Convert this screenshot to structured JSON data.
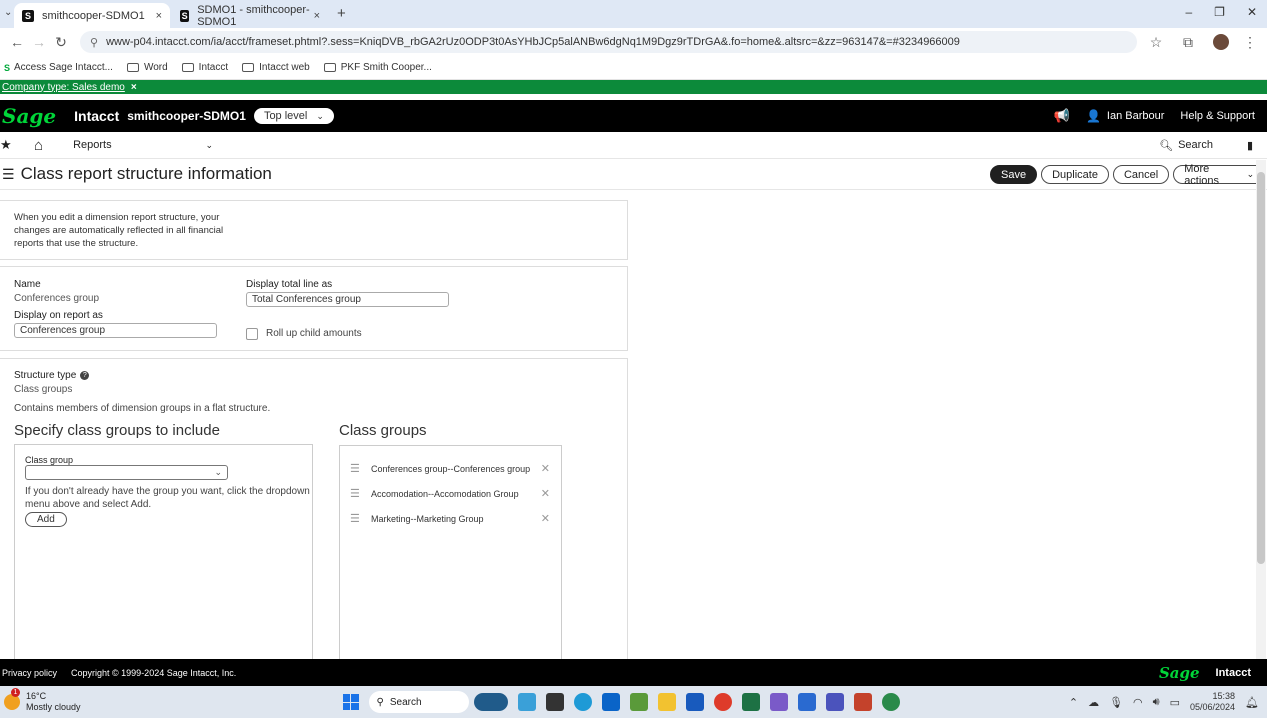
{
  "browser": {
    "tabs": [
      {
        "title": "smithcooper-SDMO1",
        "favicon": "S",
        "close": "×"
      },
      {
        "title": "SDMO1 - smithcooper-SDMO1",
        "favicon": "S",
        "close": "×"
      }
    ],
    "new_tab": "+",
    "url": "www-p04.intacct.com/ia/acct/frameset.phtml?.sess=KniqDVB_rbGA2rUz0ODP3t0AsYHbJCp5alANBw6dgNq1M9Dgz9rTDrGA&.fo=home&.altsrc=&zz=963147&=#3234966009",
    "bookmarks": [
      "Access Sage Intacct...",
      "Word",
      "Intacct",
      "Intacct web",
      "PKF Smith Cooper..."
    ]
  },
  "company_bar": {
    "text": "Company type: Sales demo",
    "close": "×"
  },
  "topnav": {
    "logo": "Sage",
    "product": "Intacct",
    "company": "smithcooper-SDMO1",
    "level": "Top level",
    "user": "Ian Barbour",
    "help": "Help & Support"
  },
  "menubar": {
    "reports": "Reports",
    "search": "Search"
  },
  "page": {
    "title": "Class report structure information",
    "actions": {
      "save": "Save",
      "duplicate": "Duplicate",
      "cancel": "Cancel",
      "more": "More actions"
    },
    "info_text": "When you edit a dimension report structure, your changes are automatically reflected in all financial reports that use the structure.",
    "name_label": "Name",
    "name_value": "Conferences group",
    "display_total_label": "Display total line as",
    "display_total_value": "Total Conferences group",
    "display_on_report_label": "Display on report as",
    "display_on_report_value": "Conferences group",
    "rollup_label": "Roll up child amounts",
    "rollup_checked": false,
    "structure_type_label": "Structure type",
    "structure_type_value": "Class groups",
    "structure_desc": "Contains members of dimension groups in a flat structure.",
    "specify_heading": "Specify class groups to include",
    "class_group_label": "Class group",
    "class_group_value": "",
    "class_group_help": "If you don't already have the group you want, click the dropdown menu above and select Add.",
    "add_button": "Add",
    "class_groups_heading": "Class groups",
    "class_groups": [
      "Conferences group--Conferences group",
      "Accomodation--Accomodation Group",
      "Marketing--Marketing Group"
    ]
  },
  "footer": {
    "privacy": "Privacy policy",
    "copyright": "Copyright © 1999-2024 Sage Intacct, Inc.",
    "brand_logo": "Sage",
    "brand_product": "Intacct"
  },
  "taskbar": {
    "weather_temp": "16°C",
    "weather_desc": "Mostly cloudy",
    "search": "Search",
    "time": "15:38",
    "date": "05/06/2024",
    "weather_badge": "1"
  },
  "colors": {
    "sage_green": "#00d639",
    "company_bar": "#0c8a3a"
  }
}
